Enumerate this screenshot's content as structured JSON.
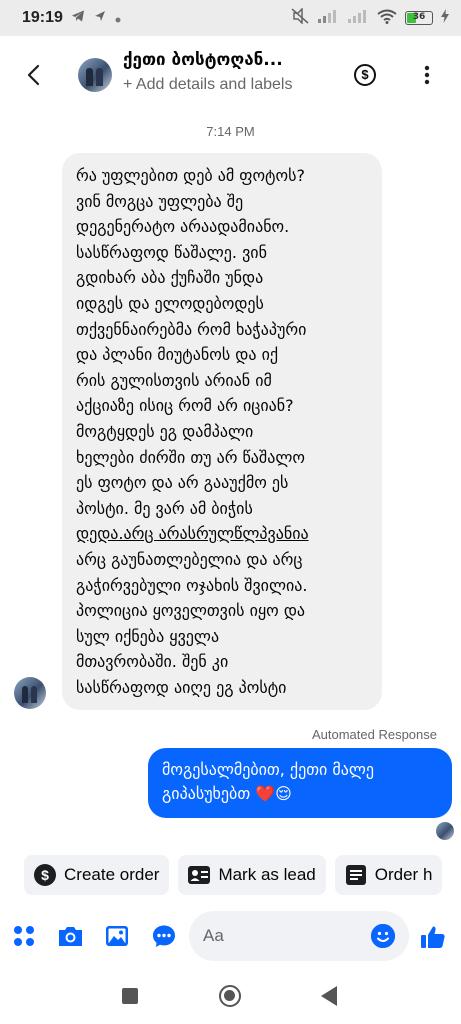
{
  "status_bar": {
    "time": "19:19",
    "battery": "36"
  },
  "header": {
    "contact_name": "ქეთი ბოსტოღან...",
    "subtitle": "+ Add details and labels"
  },
  "chat": {
    "timestamp": "7:14 PM",
    "incoming_lines": [
      "რა უფლებით დებ ამ ფოტოს?",
      "ვინ მოგცა უფლება შე",
      "დეგენერატო არაადამიანო.",
      "სასწრაფოდ წაშალე. ვინ",
      "გდიხარ აბა ქუჩაში უნდა",
      "იდგეს და ელოდებოდეს",
      "თქვენნაირებმა რომ ხაჭაპური",
      "და პლანი მიუტანოს და იქ",
      "რის გულისთვის არიან იმ",
      "აქციაზე ისიც რომ არ იციან?",
      "მოგტყდეს ეგ დამპალი",
      "ხელები ძირში თუ არ წაშალო",
      "ეს ფოტო და არ გააუქმო ეს",
      "პოსტი. მე ვარ ამ ბიჭის",
      "დედა.არც არასრულწლპვანია",
      "არც გაუნათლებელია და არც",
      "გაჭირვებული ოჯახის შვილია.",
      "პოლიცია ყოველთვის იყო და",
      "სულ იქნება ყველა",
      "მთავრობაში. შენ კი",
      "სასწრაფოდ აიღე ეგ პოსტი"
    ],
    "automated_label": "Automated Response",
    "outgoing_lines": [
      "მოგესალმებით, ქეთი   მალე",
      "გიპასუხებთ ❤️😌"
    ]
  },
  "actions": {
    "create_order": "Create order",
    "mark_as_lead": "Mark as lead",
    "order_history": "Order h"
  },
  "composer": {
    "placeholder": "Aa"
  },
  "colors": {
    "accent": "#0866ff",
    "bubble_in": "#f0f0f0"
  }
}
